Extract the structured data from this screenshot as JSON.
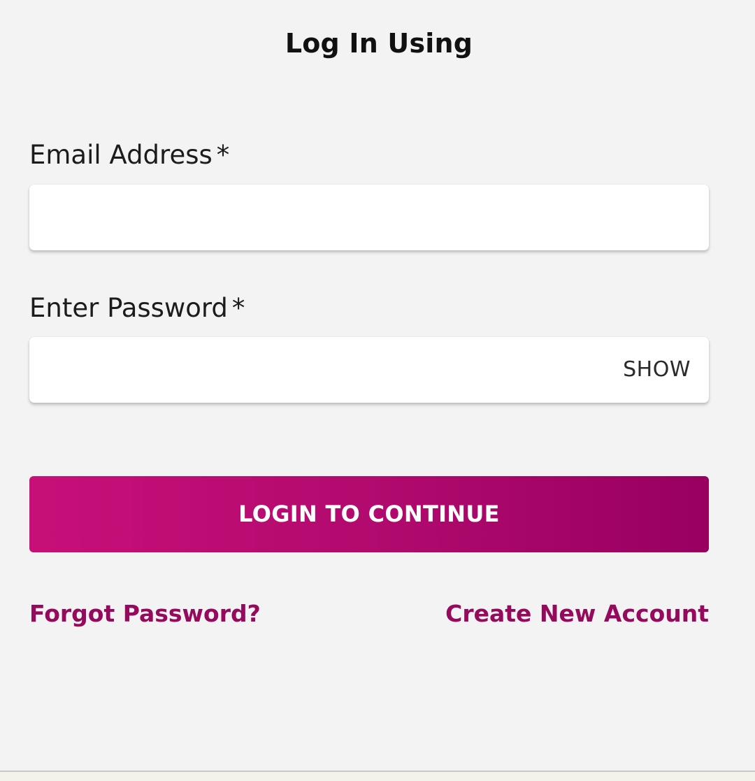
{
  "header": {
    "title": "Log In Using"
  },
  "form": {
    "email": {
      "label": "Email Address",
      "required_mark": "*",
      "value": ""
    },
    "password": {
      "label": "Enter Password",
      "required_mark": "*",
      "value": "",
      "show_label": "SHOW"
    },
    "submit_label": "LOGIN TO CONTINUE"
  },
  "links": {
    "forgot": "Forgot Password?",
    "create": "Create New Account"
  },
  "colors": {
    "background": "#f3f3f3",
    "button_gradient_start": "#c80f79",
    "button_gradient_end": "#980060",
    "link": "#950a5c"
  }
}
